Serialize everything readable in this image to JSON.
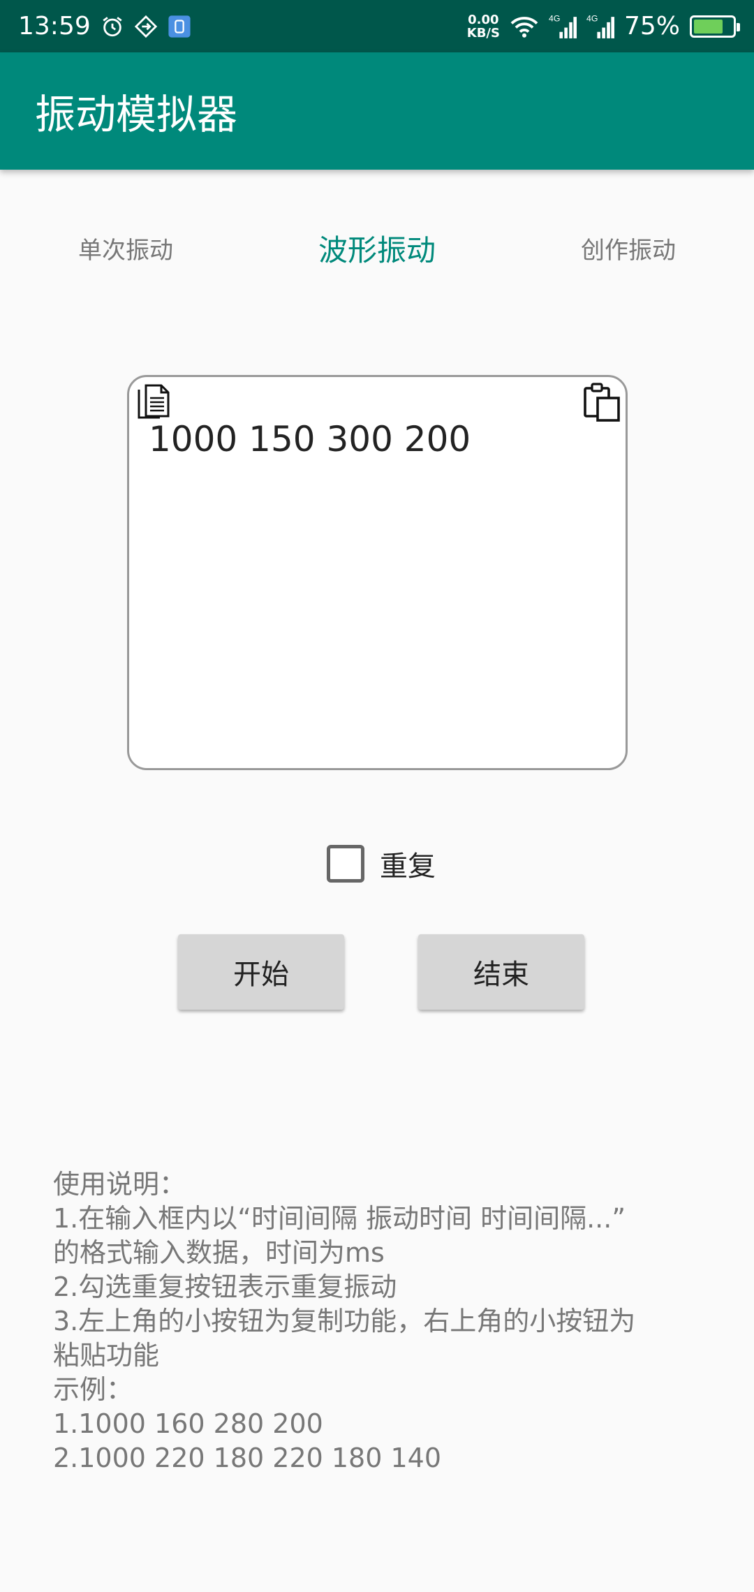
{
  "status_bar": {
    "time": "13:59",
    "net_speed_value": "0.00",
    "net_speed_unit": "KB/S",
    "signal_label_1": "4G",
    "signal_label_2": "4G",
    "battery_percent": "75%",
    "battery_level": 0.75,
    "icons": [
      "alarm-icon",
      "data-sync-icon",
      "app-notification-icon",
      "wifi-icon",
      "signal-icon",
      "battery-icon"
    ]
  },
  "app_bar": {
    "title": "振动模拟器"
  },
  "tabs": [
    {
      "label": "单次振动",
      "active": false
    },
    {
      "label": "波形振动",
      "active": true
    },
    {
      "label": "创作振动",
      "active": false
    }
  ],
  "input": {
    "value": "1000 150 300 200",
    "copy_icon": "copy-icon",
    "paste_icon": "paste-icon"
  },
  "repeat": {
    "label": "重复",
    "checked": false
  },
  "buttons": {
    "start": "开始",
    "stop": "结束"
  },
  "instructions": {
    "lines": [
      "使用说明：",
      "1.在输入框内以“时间间隔 振动时间 时间间隔...”",
      "的格式输入数据，时间为ms",
      "2.勾选重复按钮表示重复振动",
      "3.左上角的小按钮为复制功能，右上角的小按钮为",
      "粘贴功能",
      "示例：",
      "1.1000 160 280 200",
      "2.1000 220 180 220 180 140"
    ]
  },
  "colors": {
    "status_bar": "#00574b",
    "app_bar": "#00897b",
    "accent": "#00897b",
    "background": "#fafafa"
  }
}
